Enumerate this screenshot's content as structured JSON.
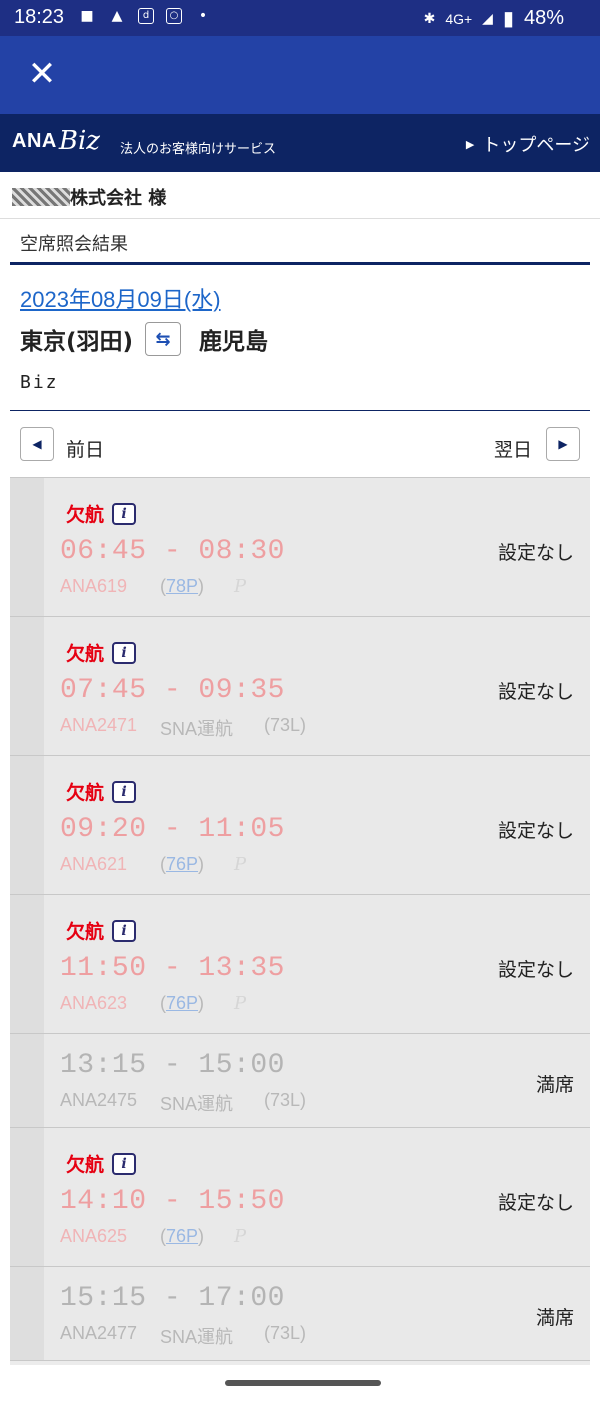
{
  "status_bar": {
    "time": "18:23",
    "network": "4G+",
    "battery": "48%"
  },
  "header": {
    "close_icon": "close-icon"
  },
  "brand": {
    "logo_ana": "ANA",
    "logo_biz": "Biz",
    "subtitle": "法人のお客様向けサービス",
    "top_link": "トップページ"
  },
  "company": {
    "name_suffix": "株式会社 様"
  },
  "section_title": "空席照会結果",
  "search": {
    "date": "2023年08月09日(水)",
    "origin": "東京(羽田)",
    "destination": "鹿児島",
    "fare_type": "Biz"
  },
  "nav": {
    "prev_label": "前日",
    "next_label": "翌日"
  },
  "flights": [
    {
      "cancelled": true,
      "cancel_label": "欠航",
      "times": "06:45 - 08:30",
      "flight_no": "ANA619",
      "operator": "",
      "aircraft": "78P",
      "status": "設定なし"
    },
    {
      "cancelled": true,
      "cancel_label": "欠航",
      "times": "07:45 - 09:35",
      "flight_no": "ANA2471",
      "operator": "SNA運航",
      "aircraft": "(73L)",
      "status": "設定なし"
    },
    {
      "cancelled": true,
      "cancel_label": "欠航",
      "times": "09:20 - 11:05",
      "flight_no": "ANA621",
      "operator": "",
      "aircraft": "76P",
      "status": "設定なし"
    },
    {
      "cancelled": true,
      "cancel_label": "欠航",
      "times": "11:50 - 13:35",
      "flight_no": "ANA623",
      "operator": "",
      "aircraft": "76P",
      "status": "設定なし"
    },
    {
      "cancelled": false,
      "cancel_label": "",
      "times": "13:15 - 15:00",
      "flight_no": "ANA2475",
      "operator": "SNA運航",
      "aircraft": "(73L)",
      "status": "満席"
    },
    {
      "cancelled": true,
      "cancel_label": "欠航",
      "times": "14:10 - 15:50",
      "flight_no": "ANA625",
      "operator": "",
      "aircraft": "76P",
      "status": "設定なし"
    },
    {
      "cancelled": false,
      "cancel_label": "",
      "times": "15:15 - 17:00",
      "flight_no": "ANA2477",
      "operator": "SNA運航",
      "aircraft": "(73L)",
      "status": "満席"
    }
  ]
}
